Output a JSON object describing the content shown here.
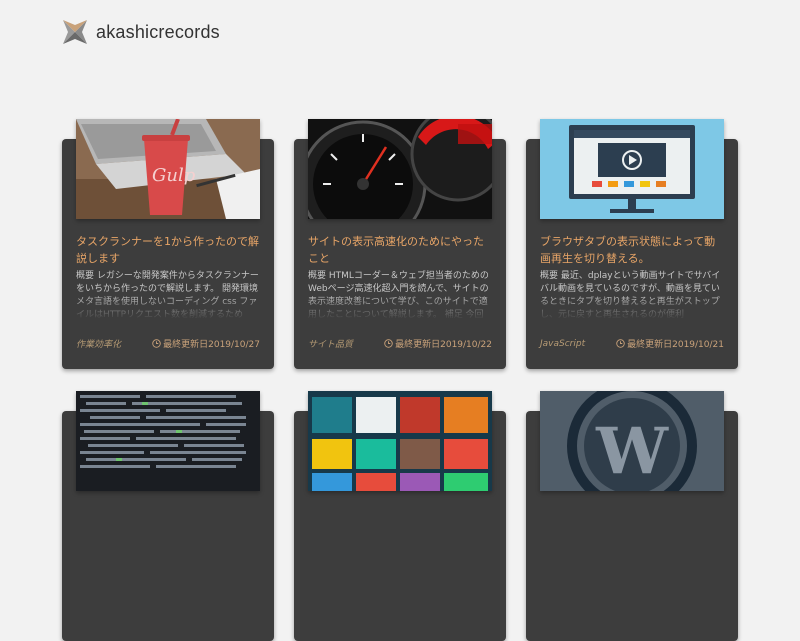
{
  "site": {
    "name": "akashicrecords"
  },
  "posts": [
    {
      "title": "タスクランナーを1から作ったので解説します",
      "excerpt": "概要 レガシーな開発案件からタスクランナーをいちから作ったので解説します。 開発環境 メタ言語を使用しないコーディング css ファイルはHTTPリクエスト数を削減するため",
      "category": "作業効率化",
      "date_label": "最終更新日2019/10/27",
      "image_icon": "gulp-cup-laptop"
    },
    {
      "title": "サイトの表示高速化のためにやったこと",
      "excerpt": "概要 HTMLコーダー＆ウェブ担当者のためのWebページ高速化超入門を読んで、サイトの表示速度改善について学び、このサイトで適用したことについて解説します。 補足 今回は",
      "category": "サイト品質",
      "date_label": "最終更新日2019/10/22",
      "image_icon": "speedometer"
    },
    {
      "title": "ブラウザタブの表示状態によって動画再生を切り替える。",
      "excerpt": "概要 最近、dplayという動画サイトでサバイバル動画を見ているのですが、動画を見ているときにタブを切り替えると再生がストップし、元に戻すと再生されるのが便利",
      "category": "JavaScript",
      "date_label": "最終更新日2019/10/21",
      "image_icon": "video-monitor"
    },
    {
      "image_icon": "code-screen"
    },
    {
      "image_icon": "color-cards"
    },
    {
      "image_icon": "wordpress-logo"
    }
  ]
}
